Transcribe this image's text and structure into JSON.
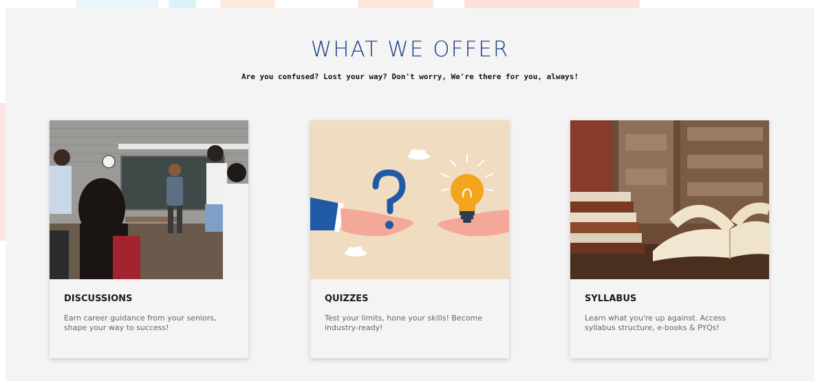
{
  "section": {
    "title": "WHAT WE OFFER",
    "subtitle": "Are you confused? Lost your way? Don't worry, We're there for you, always!"
  },
  "cards": [
    {
      "title": "DISCUSSIONS",
      "text": "Earn career guidance from your seniors, shape your way to success!",
      "image_icon": "classroom-discussion-photo"
    },
    {
      "title": "QUIZZES",
      "text": "Test your limits, hone your skills! Become industry-ready!",
      "image_icon": "question-lightbulb-illustration"
    },
    {
      "title": "SYLLABUS",
      "text": "Learn what you're up against. Access syllabus structure, e-books & PYQs!",
      "image_icon": "library-books-photo"
    }
  ],
  "colors": {
    "title": "#1f3c88",
    "background": "#f4f4f4",
    "quiz_bg": "#f0dcc0",
    "accent_blue": "#1f5aa6",
    "bulb_yellow": "#f3a51d"
  }
}
